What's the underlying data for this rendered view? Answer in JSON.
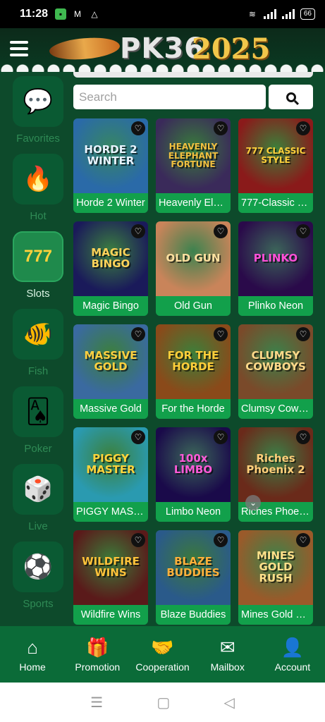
{
  "status_bar": {
    "time": "11:28",
    "battery": "66"
  },
  "header": {
    "brand": "PK36",
    "year": "2025"
  },
  "sidebar": {
    "items": [
      {
        "label": "Favorites",
        "icon": "chat-heart-icon",
        "glyph": "💬",
        "active": false
      },
      {
        "label": "Hot",
        "icon": "flame-icon",
        "glyph": "🔥",
        "active": false
      },
      {
        "label": "Slots",
        "icon": "slots-777-icon",
        "glyph": "777",
        "active": true
      },
      {
        "label": "Fish",
        "icon": "fish-icon",
        "glyph": "🐠",
        "active": false
      },
      {
        "label": "Poker",
        "icon": "cards-icon",
        "glyph": "🂡",
        "active": false
      },
      {
        "label": "Live",
        "icon": "dice-icon",
        "glyph": "🎲",
        "active": false
      },
      {
        "label": "Sports",
        "icon": "soccer-ball-icon",
        "glyph": "⚽",
        "active": false
      }
    ]
  },
  "search": {
    "placeholder": "Search"
  },
  "games": [
    {
      "label": "Horde 2 Winter",
      "art": "HORDE 2 WINTER",
      "bg": "#2a6aa8",
      "fg": "#e8f4ff"
    },
    {
      "label": "Heavenly Elephant Fortune",
      "art": "HEAVENLY ELEPHANT FORTUNE",
      "bg": "#3a2a5a",
      "fg": "#f0c040"
    },
    {
      "label": "777-Classic Style",
      "art": "777 CLASSIC STYLE",
      "bg": "#8a1a1a",
      "fg": "#ffd13b"
    },
    {
      "label": "Magic Bingo",
      "art": "MAGIC BINGO",
      "bg": "#1a1a5a",
      "fg": "#ffd35a"
    },
    {
      "label": "Old Gun",
      "art": "OLD GUN",
      "bg": "#c9845a",
      "fg": "#ffe0a0"
    },
    {
      "label": "Plinko Neon",
      "art": "PLINKO",
      "bg": "#2a0a4a",
      "fg": "#ff4fd8"
    },
    {
      "label": "Massive Gold",
      "art": "MASSIVE GOLD",
      "bg": "#3a6aa0",
      "fg": "#ffd040"
    },
    {
      "label": "For the Horde",
      "art": "FOR THE HORDE",
      "bg": "#8a4a1a",
      "fg": "#ffcf3a"
    },
    {
      "label": "Clumsy Cowboys",
      "art": "CLUMSY COWBOYS",
      "bg": "#7a4a2a",
      "fg": "#ffd98a"
    },
    {
      "label": "PIGGY MASTER",
      "art": "PIGGY MASTER",
      "bg": "#2a9ab0",
      "fg": "#ffd43b"
    },
    {
      "label": "Limbo Neon",
      "art": "100x LIMBO",
      "bg": "#1a0a4a",
      "fg": "#ff5ad8"
    },
    {
      "label": "Riches Phoenix 2",
      "art": "Riches Phoenix 2",
      "bg": "#6a2a1a",
      "fg": "#ffcf7a"
    },
    {
      "label": "Wildfire Wins",
      "art": "WILDFIRE WINS",
      "bg": "#5a1a1a",
      "fg": "#ffc23a"
    },
    {
      "label": "Blaze Buddies",
      "art": "BLAZE BUDDIES",
      "bg": "#2a5a8a",
      "fg": "#ffb03a"
    },
    {
      "label": "Mines Gold Rush",
      "art": "MINES GOLD RUSH",
      "bg": "#9a5a2a",
      "fg": "#ffe08a"
    }
  ],
  "bottom_nav": [
    {
      "label": "Home",
      "icon": "home-icon",
      "glyph": "⌂"
    },
    {
      "label": "Promotion",
      "icon": "gift-icon",
      "glyph": "🎁"
    },
    {
      "label": "Cooperation",
      "icon": "handshake-icon",
      "glyph": "🤝"
    },
    {
      "label": "Mailbox",
      "icon": "mail-icon",
      "glyph": "✉"
    },
    {
      "label": "Account",
      "icon": "account-settings-icon",
      "glyph": "👤"
    }
  ]
}
